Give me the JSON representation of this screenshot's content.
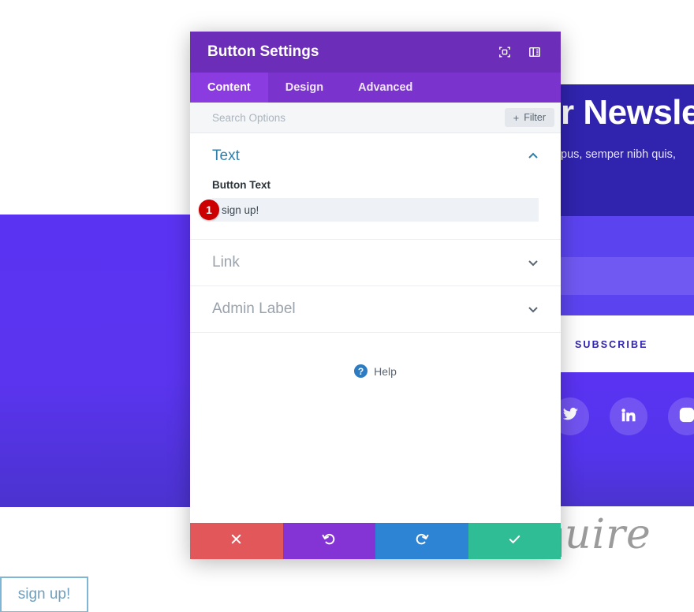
{
  "background": {
    "signup_button_label": "sign up!",
    "newsletter_title": "r Newsle",
    "newsletter_subtitle": "pus, semper nibh quis, ",
    "subscribe_label": "SUBSCRIBE",
    "script_logo_text": "uire",
    "social": [
      {
        "name": "twitter-icon",
        "label": "Twitter"
      },
      {
        "name": "linkedin-icon",
        "label": "LinkedIn"
      },
      {
        "name": "instagram-icon",
        "label": "Instagram"
      }
    ],
    "colors": {
      "left_panel": "#5a33f2",
      "newsletter_panel": "#3023ae",
      "social_strip": "#5a33f2",
      "subscribe_text": "#3023ae",
      "signup_border": "#7fb6d6",
      "signup_text": "#6f9fbe",
      "teal_chip": "#3bbfa0"
    }
  },
  "modal": {
    "title": "Button Settings",
    "header_icons": [
      {
        "name": "focus-target-icon"
      },
      {
        "name": "layout-panel-icon"
      }
    ],
    "tabs": [
      {
        "label": "Content",
        "active": true
      },
      {
        "label": "Design",
        "active": false
      },
      {
        "label": "Advanced",
        "active": false
      }
    ],
    "search": {
      "placeholder": "Search Options",
      "value": ""
    },
    "filter": {
      "label": "Filter",
      "plus": "+"
    },
    "sections": [
      {
        "title": "Text",
        "state": "open",
        "chevron": "chevron-up-icon"
      },
      {
        "title": "Link",
        "state": "closed",
        "chevron": "chevron-down-icon"
      },
      {
        "title": "Admin Label",
        "state": "closed",
        "chevron": "chevron-down-icon"
      }
    ],
    "button_text_field": {
      "label": "Button Text",
      "value": "sign up!",
      "placeholder": ""
    },
    "help": {
      "glyph": "?",
      "label": "Help"
    },
    "footer_buttons": [
      {
        "name": "cancel-button",
        "icon": "close-icon",
        "color": "#e2575a"
      },
      {
        "name": "undo-button",
        "icon": "undo-icon",
        "color": "#8434d4"
      },
      {
        "name": "redo-button",
        "icon": "redo-icon",
        "color": "#2d84d4"
      },
      {
        "name": "save-button",
        "icon": "check-icon",
        "color": "#2fbd96"
      }
    ],
    "colors": {
      "header": "#6c2eb9",
      "tabbar": "#7a33cc",
      "tab_active": "#8b3ce0",
      "section_open_title": "#2f7fab",
      "section_closed_title": "#9aa2ab"
    }
  },
  "annotation": {
    "step_number": "1",
    "color": "#cc0000"
  }
}
